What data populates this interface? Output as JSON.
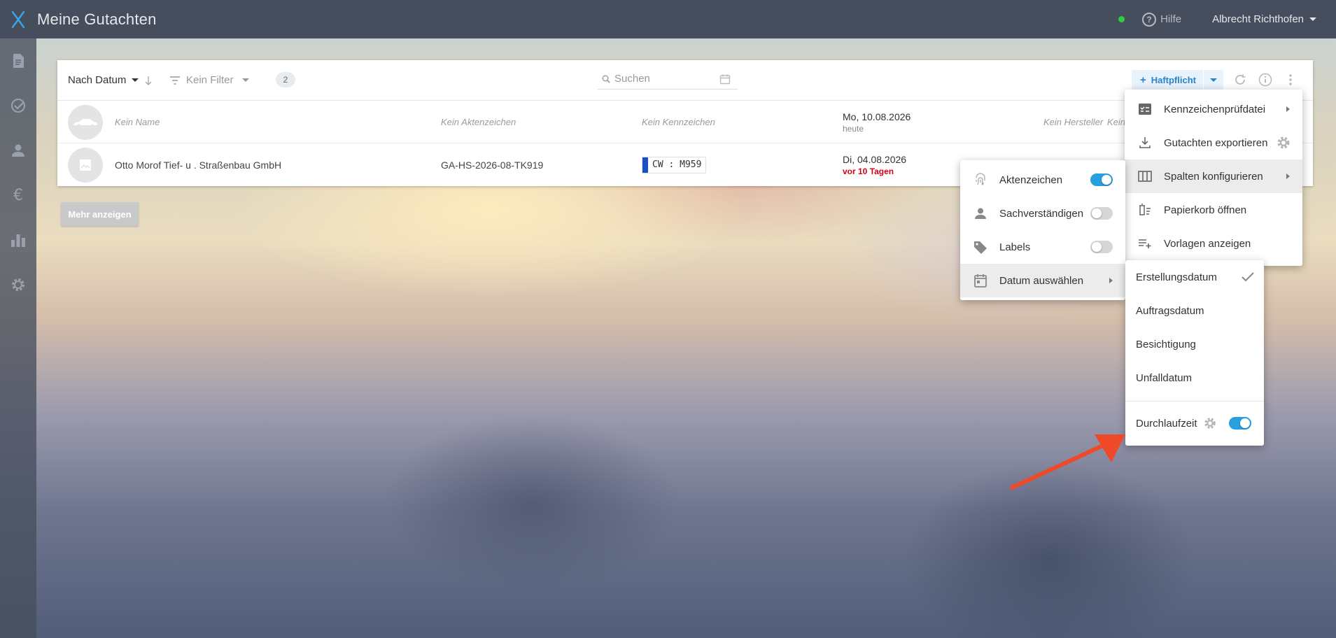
{
  "app": {
    "title": "Meine Gutachten",
    "user_name": "Albrecht Richthofen",
    "help_label": "Hilfe",
    "status_color": "#2ecc40",
    "accent_color": "#2a9fe0"
  },
  "sidebar": {
    "items": [
      {
        "icon": "document-icon"
      },
      {
        "icon": "check-circle-icon"
      },
      {
        "icon": "person-icon"
      },
      {
        "icon": "euro-icon"
      },
      {
        "icon": "bar-chart-icon"
      },
      {
        "icon": "gear-icon"
      }
    ]
  },
  "toolbar": {
    "sort_label": "Nach Datum",
    "filter_label": "Kein Filter",
    "count": "2",
    "search_placeholder": "Suchen",
    "add_label": "Haftpflicht"
  },
  "rows": [
    {
      "name": "Kein Name",
      "aktenzeichen": "Kein Aktenzeichen",
      "kennzeichen": "Kein Kennzeichen",
      "date": "Mo, 10.08.2026",
      "date_sub": "heute",
      "hersteller": "Kein Hersteller",
      "extra": "Kein"
    },
    {
      "name": "Otto Morof Tief- u . Straßenbau GmbH",
      "aktenzeichen": "GA-HS-2026-08-TK919",
      "kennzeichen": "CW : M959",
      "date": "Di, 04.08.2026",
      "date_sub": "vor 10 Tagen"
    }
  ],
  "more_button": "Mehr anzeigen",
  "main_menu": {
    "items": [
      {
        "label": "Kennzeichenprüfdatei",
        "icon": "checklist-icon",
        "has_submenu": true
      },
      {
        "label": "Gutachten exportieren",
        "icon": "download-icon"
      },
      {
        "label": "Spalten konfigurieren",
        "icon": "columns-icon",
        "has_submenu": true,
        "active": true
      },
      {
        "label": "Papierkorb öffnen",
        "icon": "trash-icon"
      },
      {
        "label": "Vorlagen anzeigen",
        "icon": "playlist-add-icon"
      }
    ]
  },
  "columns_menu": {
    "items": [
      {
        "label": "Aktenzeichen",
        "icon": "fingerprint-icon",
        "enabled": true
      },
      {
        "label": "Sachverständigen",
        "icon": "person-icon",
        "enabled": false
      },
      {
        "label": "Labels",
        "icon": "tag-icon",
        "enabled": false
      },
      {
        "label": "Datum auswählen",
        "icon": "calendar-icon",
        "has_submenu": true,
        "active": true
      }
    ]
  },
  "date_menu": {
    "items": [
      {
        "label": "Erstellungsdatum",
        "selected": true
      },
      {
        "label": "Auftragsdatum"
      },
      {
        "label": "Besichtigung"
      },
      {
        "label": "Unfalldatum"
      }
    ],
    "durchlaufzeit_label": "Durchlaufzeit",
    "durchlaufzeit_enabled": true
  },
  "annotation_arrow_color": "#ee4a2a"
}
